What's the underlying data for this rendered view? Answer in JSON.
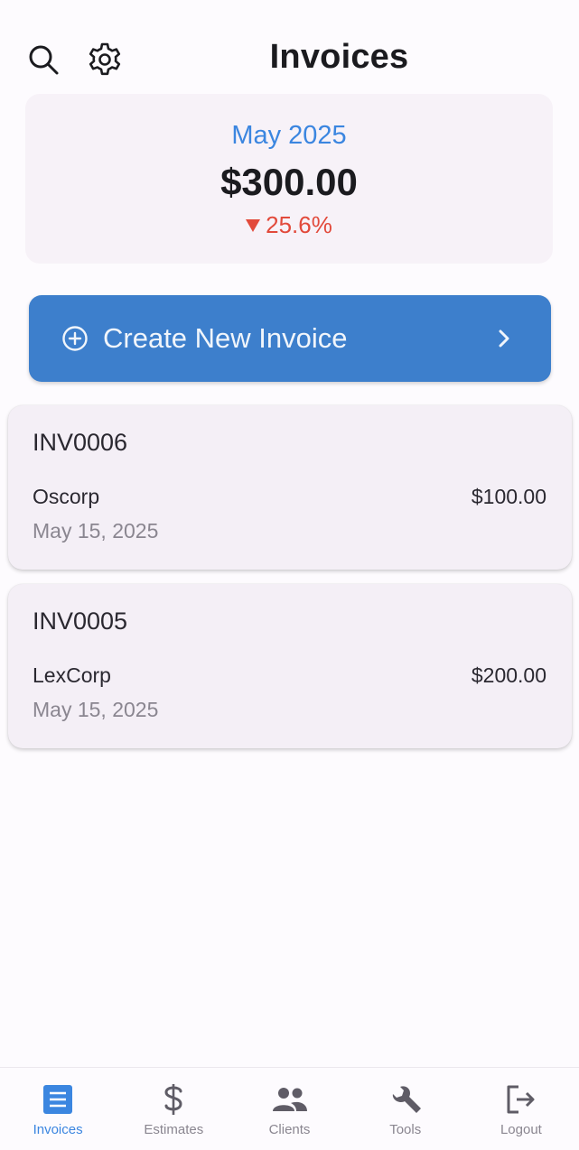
{
  "header": {
    "title": "Invoices",
    "search_icon": "search-icon",
    "settings_icon": "gear-icon"
  },
  "summary": {
    "month": "May 2025",
    "total": "$300.00",
    "change": "25.6%",
    "change_direction": "down",
    "colors": {
      "month": "#3b86e0",
      "change": "#e24a3b"
    }
  },
  "create_button": {
    "label": "Create New Invoice",
    "icon": "plus-circle-icon",
    "trailing_icon": "chevron-right-icon",
    "color": "#3d7fcc"
  },
  "invoices": [
    {
      "number": "INV0006",
      "client": "Oscorp",
      "amount": "$100.00",
      "date": "May 15, 2025"
    },
    {
      "number": "INV0005",
      "client": "LexCorp",
      "amount": "$200.00",
      "date": "May 15, 2025"
    }
  ],
  "bottom_nav": {
    "active": "Invoices",
    "items": [
      {
        "label": "Invoices",
        "icon": "list-icon"
      },
      {
        "label": "Estimates",
        "icon": "dollar-icon"
      },
      {
        "label": "Clients",
        "icon": "people-icon"
      },
      {
        "label": "Tools",
        "icon": "wrench-icon"
      },
      {
        "label": "Logout",
        "icon": "logout-icon"
      }
    ],
    "active_color": "#3b86e0"
  }
}
